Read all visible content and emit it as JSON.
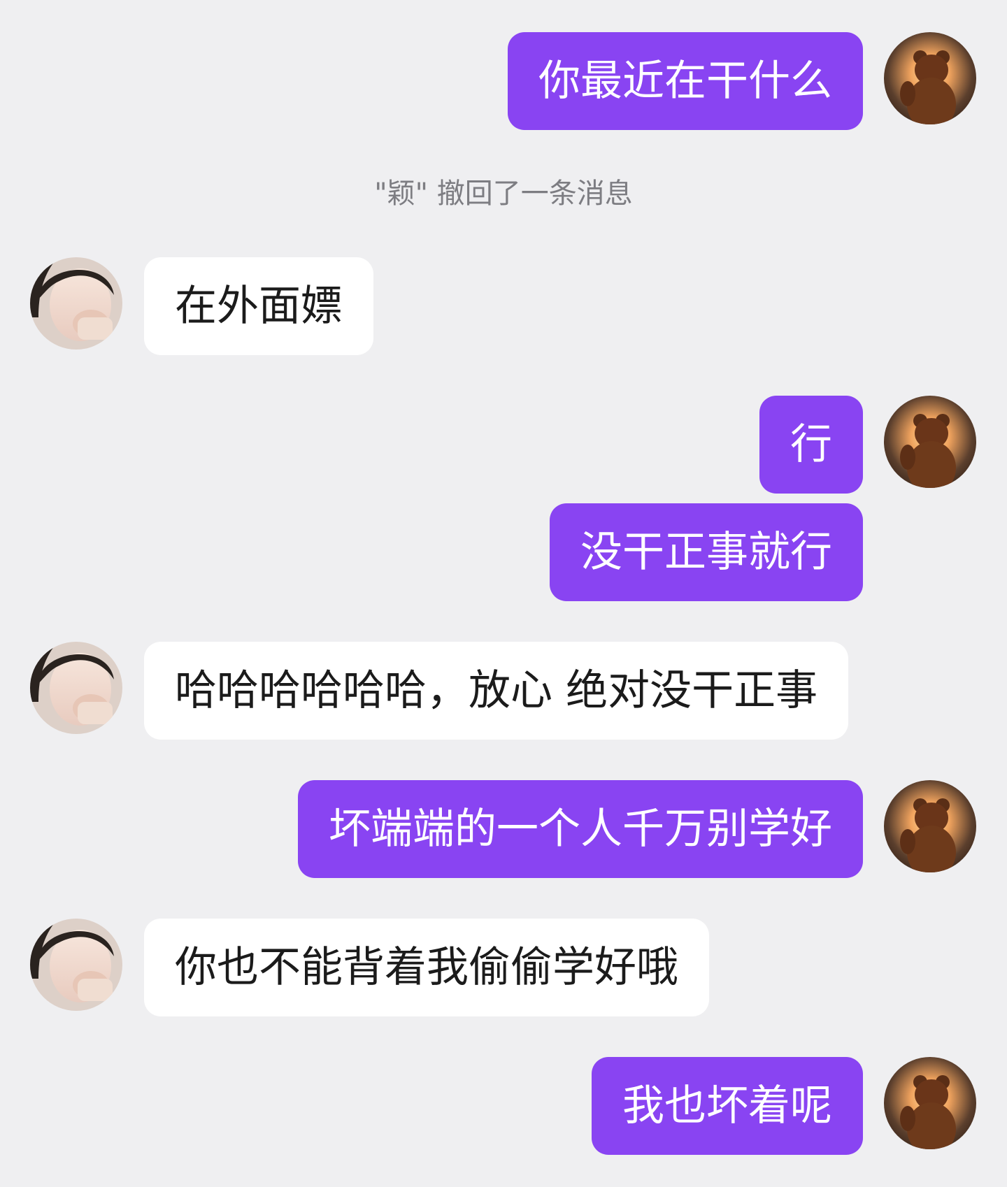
{
  "messages": [
    {
      "side": "sent",
      "text": "你最近在干什么"
    },
    {
      "side": "recv",
      "text": "在外面嫖"
    },
    {
      "side": "sent",
      "text": "行"
    },
    {
      "side": "sent",
      "text": "没干正事就行"
    },
    {
      "side": "recv",
      "text": "哈哈哈哈哈哈，放心 绝对没干正事"
    },
    {
      "side": "sent",
      "text": "坏端端的一个人千万别学好"
    },
    {
      "side": "recv",
      "text": "你也不能背着我偷偷学好哦"
    },
    {
      "side": "sent",
      "text": "我也坏着呢"
    }
  ],
  "system_note": "\"颖\" 撤回了一条消息",
  "avatars": {
    "me": "teddy-bear-sunset",
    "her": "smiling-girl-covering-mouth"
  },
  "colors": {
    "background": "#efeff1",
    "sent_bubble": "#8944f2",
    "recv_bubble": "#ffffff",
    "system_text": "#7d7d82"
  }
}
